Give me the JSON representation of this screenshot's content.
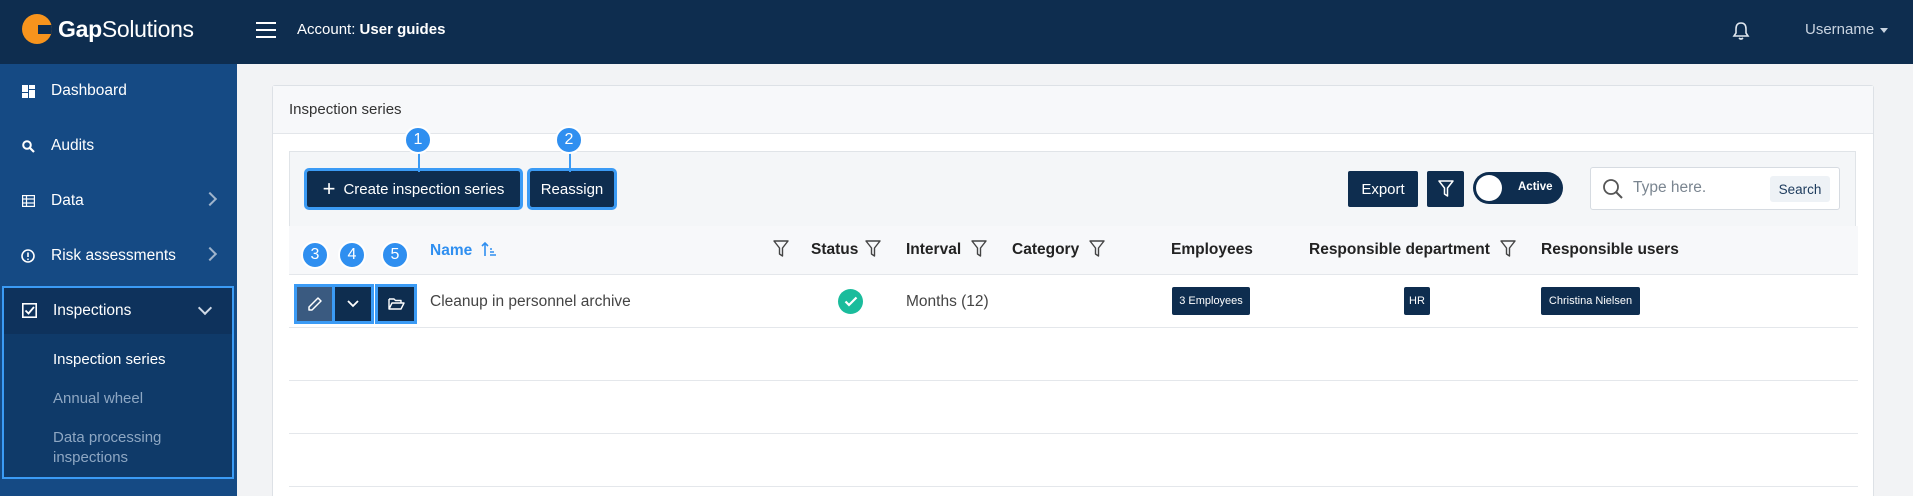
{
  "app": {
    "logo_brand_bold": "Gap",
    "logo_brand_rest": "Solutions",
    "account_label": "Account:",
    "account_name": "User guides",
    "username": "Username"
  },
  "sidebar": {
    "items": [
      {
        "label": "Dashboard",
        "icon": "dashboard-icon"
      },
      {
        "label": "Audits",
        "icon": "search-icon"
      },
      {
        "label": "Data",
        "icon": "table-icon"
      },
      {
        "label": "Risk assessments",
        "icon": "alert-circle-icon"
      },
      {
        "label": "Inspections",
        "icon": "checkbox-icon"
      }
    ],
    "inspections_sub": [
      {
        "label": "Inspection series",
        "active": true
      },
      {
        "label": "Annual wheel",
        "active": false
      },
      {
        "label": "Data processing",
        "active": false
      },
      {
        "label": "inspections",
        "active": false
      }
    ]
  },
  "panel": {
    "title": "Inspection series"
  },
  "toolbar": {
    "create_label": "Create inspection series",
    "reassign_label": "Reassign",
    "export_label": "Export",
    "toggle_label": "Active",
    "search_placeholder": "Type here.",
    "search_button": "Search"
  },
  "markers": [
    "1",
    "2",
    "3",
    "4",
    "5"
  ],
  "table": {
    "columns": {
      "name": "Name",
      "status": "Status",
      "interval": "Interval",
      "category": "Category",
      "employees": "Employees",
      "responsible_department": "Responsible department",
      "responsible_users": "Responsible users"
    },
    "rows": [
      {
        "name": "Cleanup in personnel archive",
        "status": "active",
        "interval": "Months (12)",
        "category": "",
        "employees": "3 Employees",
        "department": "HR",
        "users": "Christina Nielsen"
      }
    ]
  },
  "colors": {
    "navy": "#0e2d4f",
    "sidebar": "#154a84",
    "highlight": "#3b9bf5",
    "status_green": "#1abc9c",
    "logo_orange": "#f7941d"
  }
}
